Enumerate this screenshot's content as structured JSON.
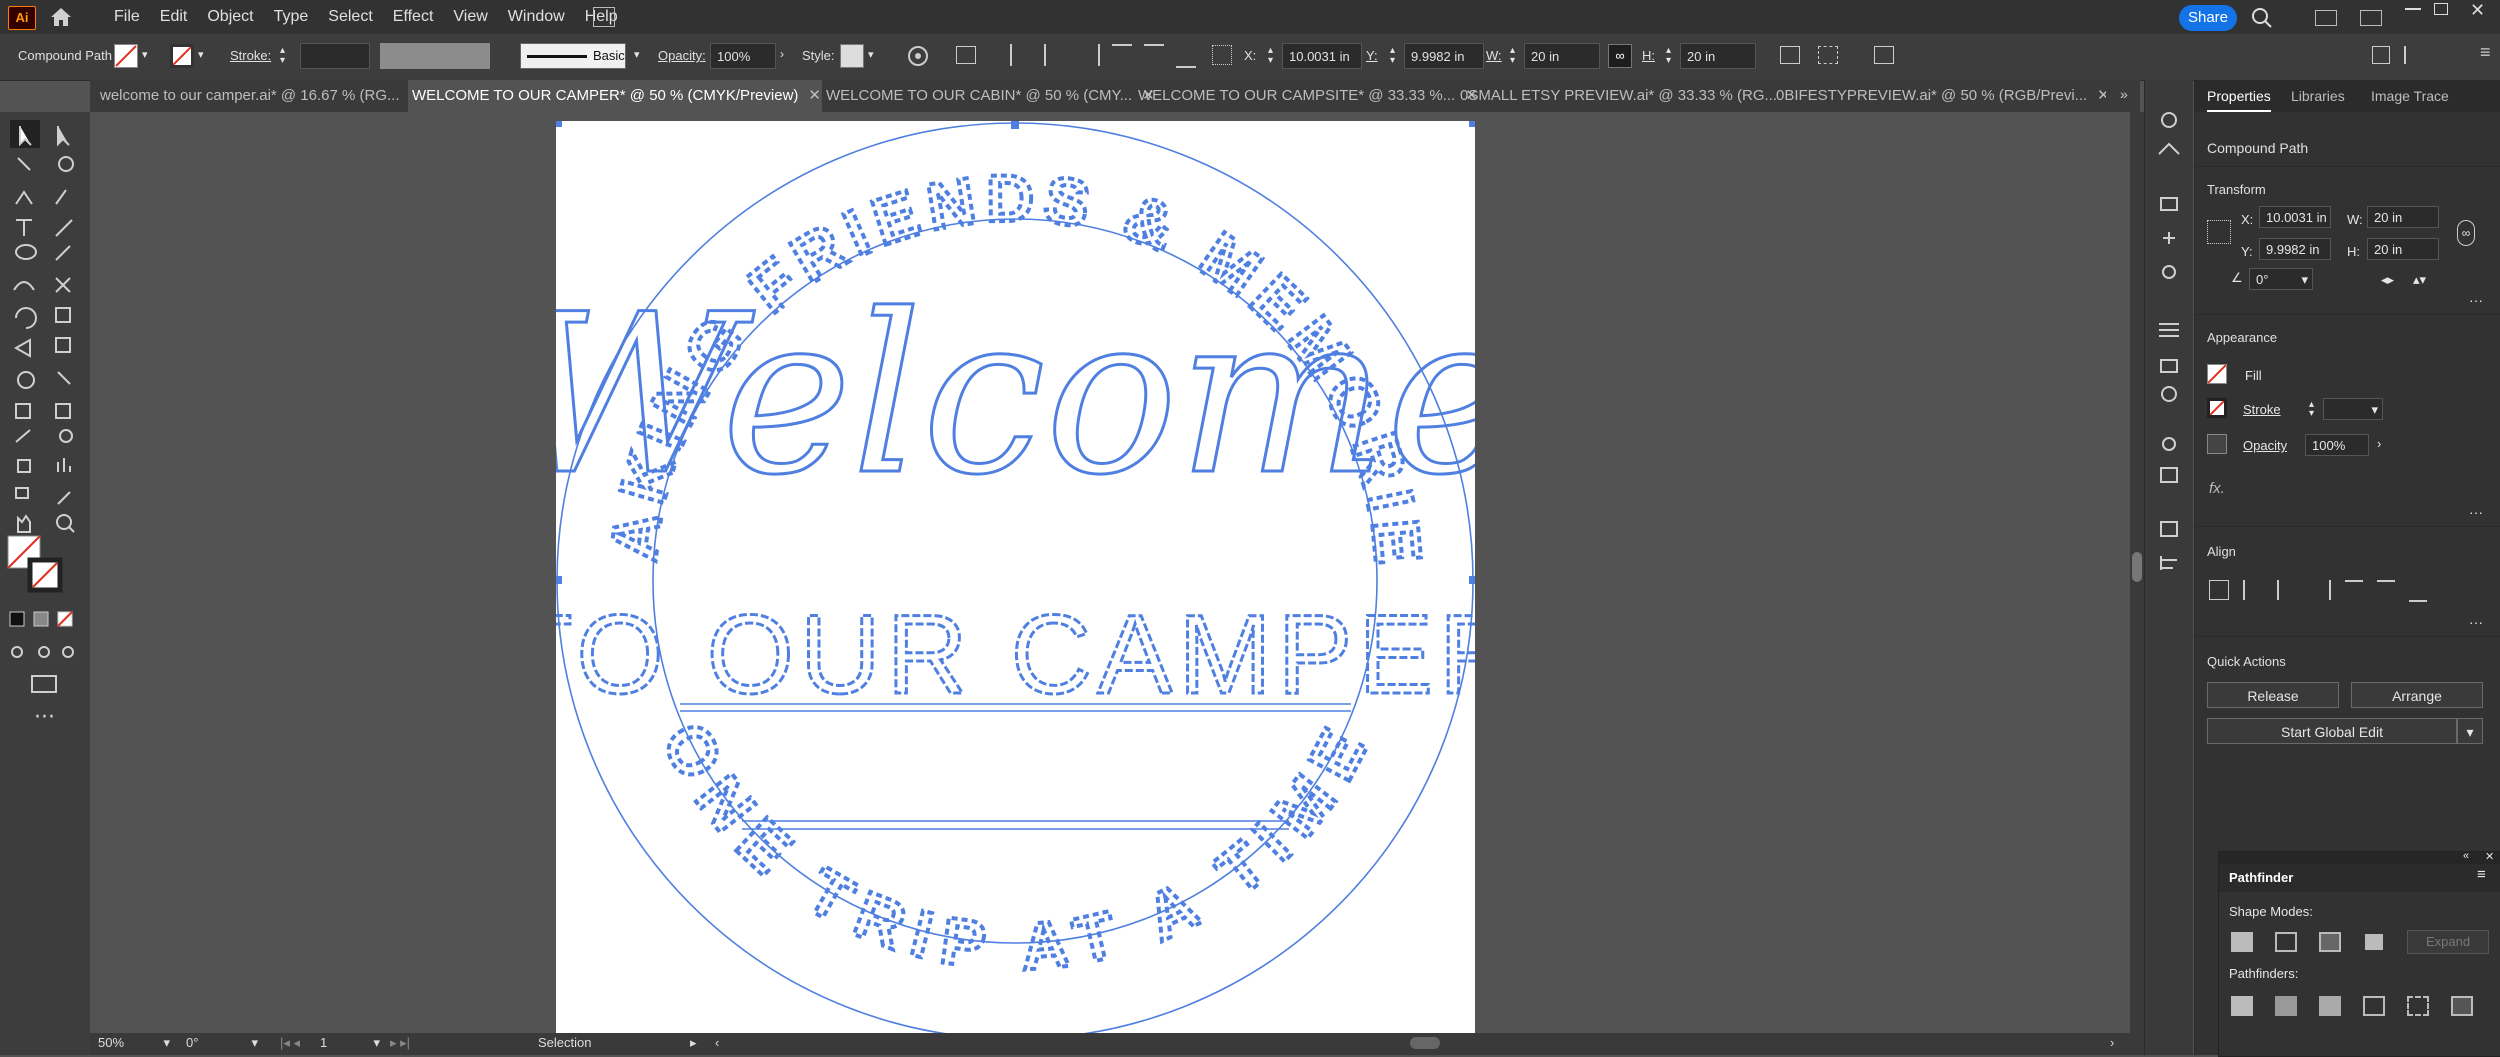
{
  "app": {
    "logo": "Ai",
    "share_label": "Share"
  },
  "menu": [
    "File",
    "Edit",
    "Object",
    "Type",
    "Select",
    "Effect",
    "View",
    "Window",
    "Help"
  ],
  "control": {
    "object_type": "Compound Path",
    "stroke_label": "Stroke:",
    "stroke_style": "Basic",
    "opacity_label": "Opacity:",
    "opacity_value": "100%",
    "style_label": "Style:",
    "x_label": "X:",
    "x_value": "10.0031 in",
    "y_label": "Y:",
    "y_value": "9.9982 in",
    "w_label": "W:",
    "w_value": "20 in",
    "h_label": "H:",
    "h_value": "20 in"
  },
  "tabs": [
    {
      "label": "welcome to our camper.ai* @ 16.67 % (RG...",
      "active": false
    },
    {
      "label": "WELCOME TO OUR CAMPER* @ 50 % (CMYK/Preview)",
      "active": true
    },
    {
      "label": "WELCOME TO OUR CABIN* @ 50 % (CMY...",
      "active": false
    },
    {
      "label": "WELCOME TO OUR CAMPSITE* @ 33.33 %...",
      "active": false
    },
    {
      "label": "0SMALL ETSY PREVIEW.ai* @ 33.33 % (RG...",
      "active": false
    },
    {
      "label": "0BIFESTYPREVIEW.ai* @ 50 % (RGB/Previ...",
      "active": false
    }
  ],
  "status": {
    "zoom": "50%",
    "rotation": "0°",
    "artboard": "1",
    "tool": "Selection"
  },
  "properties": {
    "tabs": [
      "Properties",
      "Libraries",
      "Image Trace"
    ],
    "object_type": "Compound Path",
    "transform": {
      "title": "Transform",
      "x_label": "X:",
      "x": "10.0031 in",
      "y_label": "Y:",
      "y": "9.9982 in",
      "w_label": "W:",
      "w": "20 in",
      "h_label": "H:",
      "h": "20 in",
      "angle": "0°"
    },
    "appearance": {
      "title": "Appearance",
      "fill_label": "Fill",
      "stroke_label": "Stroke",
      "opacity_label": "Opacity",
      "opacity_value": "100%",
      "fx_label": "fx."
    },
    "align_title": "Align",
    "quick_actions": {
      "title": "Quick Actions",
      "release": "Release",
      "arrange": "Arrange",
      "global_edit": "Start Global Edit"
    }
  },
  "pathfinder": {
    "title": "Pathfinder",
    "shape_modes": "Shape Modes:",
    "pathfinders": "Pathfinders:",
    "expand": "Expand"
  },
  "artwork": {
    "script_word": "Welcome",
    "line2": "TO OUR CAMPER",
    "ring_top": "MAKING FRIENDS & MEMORIES",
    "ring_bottom": "ONE TRIP AT A TIME"
  },
  "colors": {
    "accent": "#1473e6",
    "path": "#4f7fe0",
    "artboard": "#ffffff"
  }
}
